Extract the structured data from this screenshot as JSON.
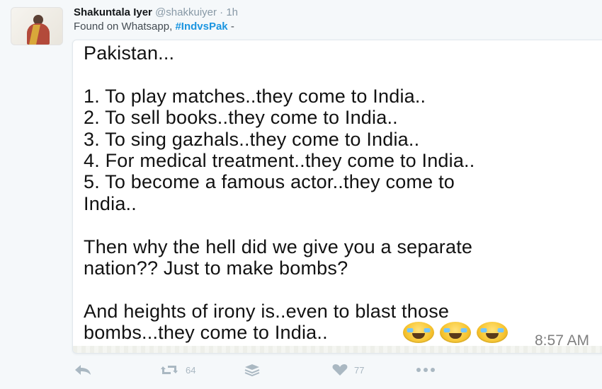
{
  "tweet": {
    "author_name": "Shakuntala Iyer",
    "author_handle": "@shakkuiyer",
    "separator": "·",
    "time_ago": "1h",
    "text_prefix": "Found on Whatsapp,",
    "hashtag": "#IndvsPak",
    "text_suffix": "-"
  },
  "media_card": {
    "text": "Pakistan...\n\n1. To play matches..they come to India..\n2. To sell books..they come to India..\n3. To sing gazhals..they come to India..\n4. For medical treatment..they come to India..\n5. To become a famous actor..they come to\nIndia..\n\nThen why the hell did we give you a separate\nnation?? Just to make bombs?\n\nAnd heights of irony is..even to blast those\nbombs...they come to India..",
    "emojis": [
      "tears-of-joy-icon",
      "tears-of-joy-icon",
      "tears-of-joy-icon"
    ],
    "timestamp": "8:57 AM"
  },
  "actions": {
    "reply_icon": "reply-icon",
    "retweet_icon": "retweet-icon",
    "retweet_count": "64",
    "layers_icon": "layers-icon",
    "like_icon": "heart-icon",
    "like_count": "77",
    "more_icon": "more-icon"
  },
  "colors": {
    "hashtag": "#1b95e0",
    "muted": "#8899a6",
    "action_icon": "#aab8c2"
  }
}
